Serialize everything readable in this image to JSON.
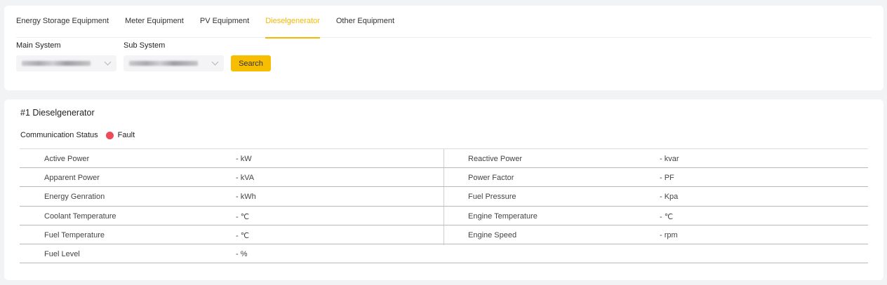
{
  "tabs": [
    {
      "label": "Energy Storage Equipment",
      "active": false
    },
    {
      "label": "Meter Equipment",
      "active": false
    },
    {
      "label": "PV Equipment",
      "active": false
    },
    {
      "label": "Dieselgenerator",
      "active": true
    },
    {
      "label": "Other Equipment",
      "active": false
    }
  ],
  "filters": {
    "main_system_label": "Main System",
    "sub_system_label": "Sub System",
    "search_label": "Search"
  },
  "device": {
    "title": "#1 Dieselgenerator",
    "comm_label": "Communication Status",
    "comm_status": "Fault",
    "status_color": "#ef4a58"
  },
  "metrics": [
    {
      "left_label": "Active Power",
      "left_value": "-  kW",
      "right_label": "Reactive Power",
      "right_value": "-  kvar"
    },
    {
      "left_label": "Apparent Power",
      "left_value": "-  kVA",
      "right_label": "Power Factor",
      "right_value": "-  PF"
    },
    {
      "left_label": "Energy Genration",
      "left_value": "-  kWh",
      "right_label": "Fuel Pressure",
      "right_value": "-  Kpa"
    },
    {
      "left_label": "Coolant Temperature",
      "left_value": "-  ℃",
      "right_label": "Engine Temperature",
      "right_value": "-  ℃"
    },
    {
      "left_label": "Fuel Temperature",
      "left_value": "-  ℃",
      "right_label": "Engine Speed",
      "right_value": "-  rpm"
    },
    {
      "left_label": "Fuel Level",
      "left_value": "-  %",
      "right_label": "",
      "right_value": ""
    }
  ],
  "colors": {
    "accent": "#f7bd00",
    "background": "#f2f3f5"
  }
}
